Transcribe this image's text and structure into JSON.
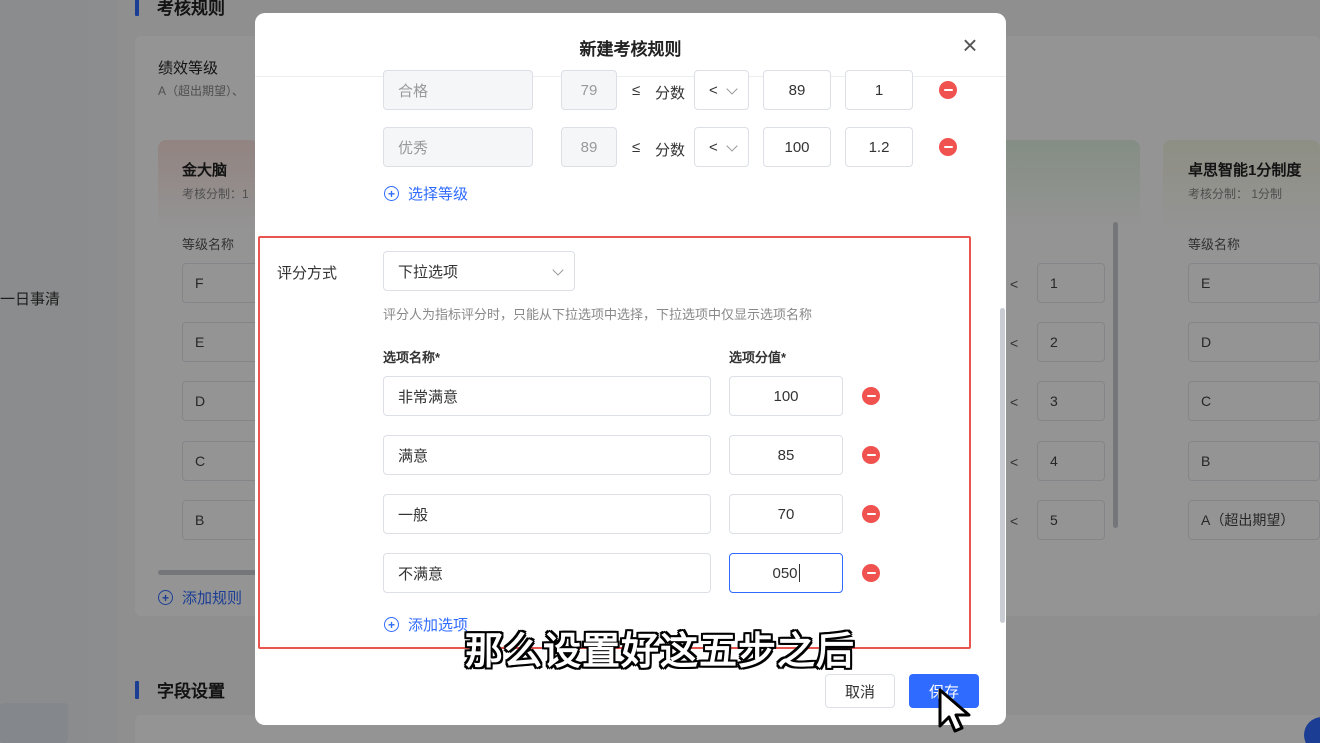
{
  "background": {
    "nav_item": "一日事清",
    "rules_section_title": "考核规则",
    "fields_section_title": "字段设置",
    "perf_title": "绩效等级",
    "perf_sub": "A（超出期望）、",
    "card1": {
      "name": "金大脑",
      "sub": "考核分制：1",
      "col": "等级名称",
      "grades": [
        "F",
        "E",
        "D",
        "C",
        "B"
      ]
    },
    "card2": {
      "lt": "<",
      "values": [
        "1",
        "2",
        "3",
        "4",
        "5"
      ]
    },
    "card3": {
      "name": "卓思智能1分制度",
      "sub": "考核分制：  1分制",
      "col": "等级名称",
      "grades": [
        "E",
        "D",
        "C",
        "B",
        "A（超出期望）"
      ]
    },
    "add_rule": "添加规则"
  },
  "modal": {
    "title": "新建考核规则",
    "close": "×",
    "grade_rows": [
      {
        "name": "合格",
        "min": "79",
        "le": "≤",
        "label": "分数",
        "op": "<",
        "max": "89",
        "coef": "1"
      },
      {
        "name": "优秀",
        "min": "89",
        "le": "≤",
        "label": "分数",
        "op": "<",
        "max": "100",
        "coef": "1.2"
      }
    ],
    "select_grade": "选择等级",
    "scoring": {
      "label": "评分方式",
      "method": "下拉选项",
      "hint": "评分人为指标评分时，只能从下拉选项中选择，下拉选项中仅显示选项名称",
      "col_name": "选项名称*",
      "col_value": "选项分值*",
      "options": [
        {
          "name": "非常满意",
          "value": "100"
        },
        {
          "name": "满意",
          "value": "85"
        },
        {
          "name": "一般",
          "value": "70"
        },
        {
          "name": "不满意",
          "value": "050"
        }
      ],
      "add_option": "添加选项"
    },
    "cancel": "取消",
    "save": "保存"
  },
  "subtitle": "那么设置好这五步之后"
}
